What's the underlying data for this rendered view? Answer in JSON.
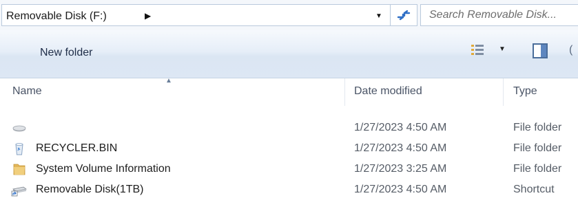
{
  "address": {
    "crumb": "Removable Disk (F:)",
    "crumb_arrow": "▶",
    "dropdown_arrow": "▼"
  },
  "search": {
    "placeholder": "Search Removable Disk..."
  },
  "toolbar": {
    "new_folder_label": "New folder",
    "view_dropdown": "▼",
    "cut_text": "("
  },
  "columns": {
    "name": "Name",
    "date_modified": "Date modified",
    "type": "Type",
    "sort_indicator": "▲"
  },
  "files": [
    {
      "name": "",
      "date": "1/27/2023 4:50 AM",
      "type": "File folder",
      "icon": "drive-icon"
    },
    {
      "name": "RECYCLER.BIN",
      "date": "1/27/2023 4:50 AM",
      "type": "File folder",
      "icon": "recycle-bin-icon"
    },
    {
      "name": "System Volume Information",
      "date": "1/27/2023 3:25 AM",
      "type": "File folder",
      "icon": "folder-icon"
    },
    {
      "name": "Removable Disk(1TB)",
      "date": "1/27/2023 4:50 AM",
      "type": "Shortcut",
      "icon": "shortcut-drive-icon"
    }
  ],
  "colors": {
    "border": "#b9c9dc",
    "toolbar_top": "#f6f9fd",
    "toolbar_bottom": "#dde7f4",
    "refresh_arrow": "#2f6fc6",
    "folder": "#e2b65a"
  }
}
